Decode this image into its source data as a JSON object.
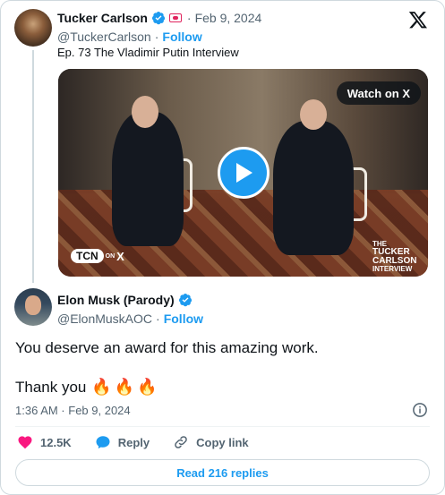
{
  "quoted_tweet": {
    "author_name": "Tucker Carlson",
    "handle": "@TuckerCarlson",
    "separator": "·",
    "follow_label": "Follow",
    "date": "Feb 9, 2024",
    "text": "Ep. 73  The Vladimir Putin Interview",
    "media": {
      "watch_label": "Watch on X",
      "channel_badge": "TCN",
      "channel_on": "ON",
      "channel_platform": "X",
      "watermark_line1": "THE",
      "watermark_line2": "TUCKER",
      "watermark_line3": "CARLSON",
      "watermark_line4": "INTERVIEW"
    },
    "icons": [
      "verified-icon",
      "affiliate-badge-icon",
      "x-logo-icon",
      "play-icon"
    ]
  },
  "tweet": {
    "author_name": "Elon Musk (Parody)",
    "handle": "@ElonMuskAOC",
    "separator": "·",
    "follow_label": "Follow",
    "text_line1": "You deserve an award for this amazing work.",
    "text_line2": "Thank you",
    "emoji": [
      "🔥",
      "🔥",
      "🔥"
    ],
    "timestamp": "1:36 AM · Feb 9, 2024"
  },
  "actions": {
    "likes_count": "12.5K",
    "reply_label": "Reply",
    "copy_link_label": "Copy link",
    "read_replies_label": "Read 216 replies"
  },
  "colors": {
    "accent": "#1d9bf0",
    "like": "#f91880",
    "text": "#0f1419",
    "muted": "#536471",
    "border": "#cfd9de"
  }
}
